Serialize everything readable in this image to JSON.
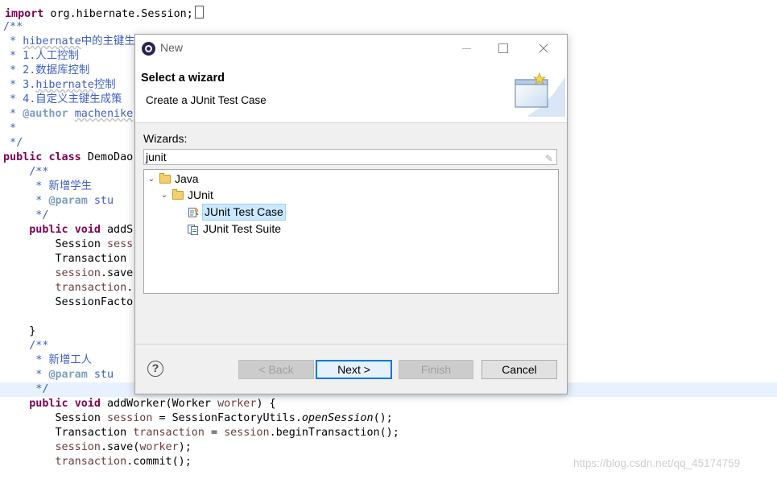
{
  "editor": {
    "lines": [
      [
        {
          "t": "import",
          "c": "kw"
        },
        {
          "t": " org.hibernate.Session;"
        }
      ],
      [
        {
          "t": "/**",
          "c": "cm"
        }
      ],
      [
        {
          "t": " * ",
          "c": "cm"
        },
        {
          "t": "hibernate",
          "c": "cm sq"
        },
        {
          "t": "中的主键生",
          "c": "cm"
        }
      ],
      [
        {
          "t": " * 1.人工控制",
          "c": "cm"
        }
      ],
      [
        {
          "t": " * 2.数据库控制",
          "c": "cm"
        }
      ],
      [
        {
          "t": " * 3.",
          "c": "cm"
        },
        {
          "t": "hibernate",
          "c": "cm sq"
        },
        {
          "t": "控制",
          "c": "cm"
        }
      ],
      [
        {
          "t": " * 4.自定义主键生成策",
          "c": "cm"
        }
      ],
      [
        {
          "t": " * ",
          "c": "cm"
        },
        {
          "t": "@author",
          "c": "tag"
        },
        {
          "t": " ",
          "c": "cm"
        },
        {
          "t": "machenike",
          "c": "cm sq"
        }
      ],
      [
        {
          "t": " *",
          "c": "cm"
        }
      ],
      [
        {
          "t": " */",
          "c": "cm"
        }
      ],
      [
        {
          "t": "public",
          "c": "kw"
        },
        {
          "t": " "
        },
        {
          "t": "class",
          "c": "kw"
        },
        {
          "t": " DemoDao"
        }
      ],
      [
        {
          "t": "    /**",
          "c": "cm"
        }
      ],
      [
        {
          "t": "     * 新增学生",
          "c": "cm"
        }
      ],
      [
        {
          "t": "     * ",
          "c": "cm"
        },
        {
          "t": "@param",
          "c": "tag"
        },
        {
          "t": " stu",
          "c": "cm"
        }
      ],
      [
        {
          "t": "     */",
          "c": "cm"
        }
      ],
      [
        {
          "t": "    "
        },
        {
          "t": "public",
          "c": "kw"
        },
        {
          "t": " "
        },
        {
          "t": "void",
          "c": "kw"
        },
        {
          "t": " addS"
        }
      ],
      [
        {
          "t": "        Session "
        },
        {
          "t": "sess",
          "c": "var"
        }
      ],
      [
        {
          "t": "        Transaction "
        }
      ],
      [
        {
          "t": "        "
        },
        {
          "t": "session",
          "c": "var"
        },
        {
          "t": ".save"
        }
      ],
      [
        {
          "t": "        "
        },
        {
          "t": "transaction",
          "c": "var"
        },
        {
          "t": "."
        }
      ],
      [
        {
          "t": "        SessionFacto"
        }
      ],
      [
        {
          "t": ""
        }
      ],
      [
        {
          "t": "    }"
        }
      ],
      [
        {
          "t": "    /**",
          "c": "cm"
        }
      ],
      [
        {
          "t": "     * 新增工人",
          "c": "cm"
        }
      ],
      [
        {
          "t": "     * ",
          "c": "cm"
        },
        {
          "t": "@param",
          "c": "tag"
        },
        {
          "t": " stu",
          "c": "cm"
        }
      ],
      [
        {
          "t": "     */",
          "c": "cm"
        }
      ],
      [
        {
          "t": "    "
        },
        {
          "t": "public",
          "c": "kw"
        },
        {
          "t": " "
        },
        {
          "t": "void",
          "c": "kw"
        },
        {
          "t": " addWorker(Worker "
        },
        {
          "t": "worker",
          "c": "var"
        },
        {
          "t": ") {"
        }
      ],
      [
        {
          "t": "        Session "
        },
        {
          "t": "session",
          "c": "var"
        },
        {
          "t": " = SessionFactoryUtils."
        },
        {
          "t": "openSession",
          "c": "it"
        },
        {
          "t": "();"
        }
      ],
      [
        {
          "t": "        Transaction "
        },
        {
          "t": "transaction",
          "c": "var"
        },
        {
          "t": " = "
        },
        {
          "t": "session",
          "c": "var"
        },
        {
          "t": ".beginTransaction();"
        }
      ],
      [
        {
          "t": "        "
        },
        {
          "t": "session",
          "c": "var"
        },
        {
          "t": ".save("
        },
        {
          "t": "worker",
          "c": "var"
        },
        {
          "t": ");"
        }
      ],
      [
        {
          "t": "        "
        },
        {
          "t": "transaction",
          "c": "var"
        },
        {
          "t": ".commit();"
        }
      ]
    ]
  },
  "watermark": "https://blog.csdn.net/qq_45174759",
  "dialog": {
    "title": "New",
    "header_title": "Select a wizard",
    "header_desc": "Create a JUnit Test Case",
    "wizards_label": "Wizards:",
    "filter_value": "junit",
    "filter_clear_icon": "eraser-icon",
    "tree": {
      "java": "Java",
      "junit": "JUnit",
      "test_case": "JUnit Test Case",
      "test_suite": "JUnit Test Suite"
    },
    "buttons": {
      "help": "?",
      "back": "< Back",
      "next": "Next >",
      "finish": "Finish",
      "cancel": "Cancel"
    },
    "colors": {
      "selection": "#cce8ff",
      "default_button_border": "#0078d7"
    }
  }
}
